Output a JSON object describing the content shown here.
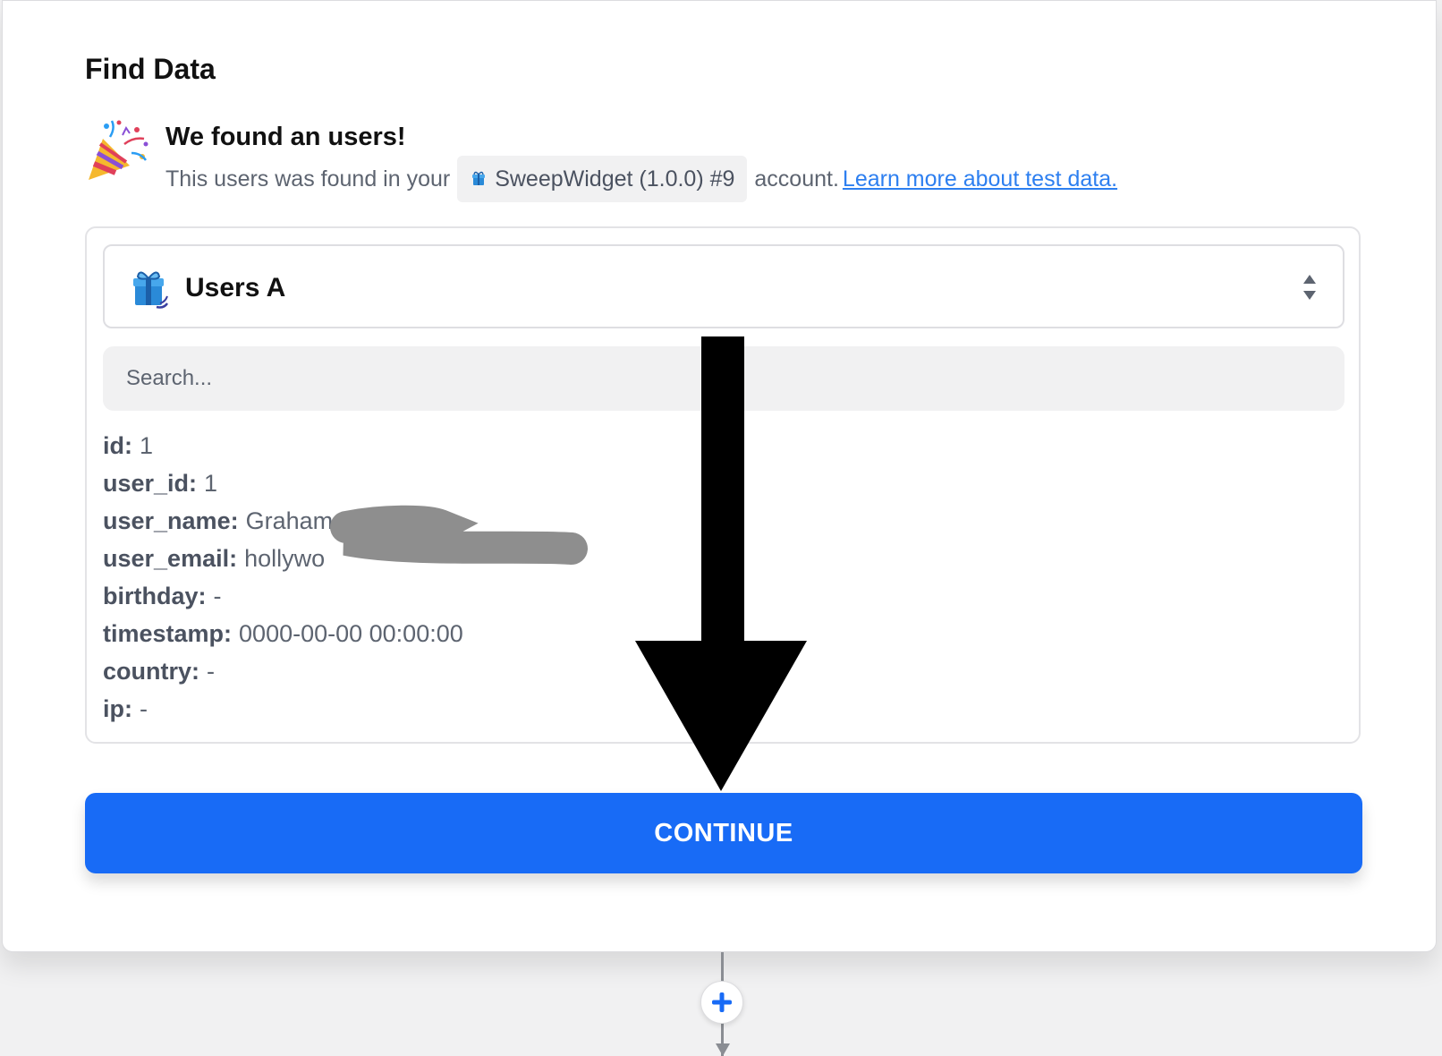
{
  "find_data": {
    "title": "Find Data",
    "found_title": "We found an users!",
    "found_prefix": "This users was found in your",
    "app_chip_label": "SweepWidget (1.0.0) #9",
    "found_suffix": "account.",
    "learn_more_link": "Learn more about test data."
  },
  "record_select": {
    "selected_label": "Users A",
    "icon": "gift-box-icon"
  },
  "search": {
    "placeholder": "Search..."
  },
  "fields": [
    {
      "key": "id:",
      "value": "1"
    },
    {
      "key": "user_id:",
      "value": "1"
    },
    {
      "key": "user_name:",
      "value": "Graham"
    },
    {
      "key": "user_email:",
      "value": "hollywo"
    },
    {
      "key": "birthday:",
      "value": "-"
    },
    {
      "key": "timestamp:",
      "value": "0000-00-00 00:00:00"
    },
    {
      "key": "country:",
      "value": "-"
    },
    {
      "key": "ip:",
      "value": "-"
    }
  ],
  "actions": {
    "continue_label": "CONTINUE"
  },
  "colors": {
    "primary": "#186bf6",
    "link": "#2d7ff0",
    "redaction": "#8e8e8e",
    "annotation_arrow": "#000000"
  }
}
